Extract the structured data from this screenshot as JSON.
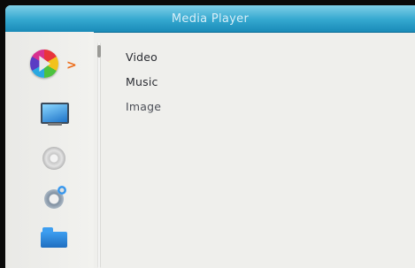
{
  "window": {
    "title": "Media Player"
  },
  "sidebar": {
    "items": [
      {
        "icon": "media-play-icon",
        "selected": true
      },
      {
        "icon": "monitor-icon",
        "selected": false
      },
      {
        "icon": "disc-icon",
        "selected": false
      },
      {
        "icon": "settings-gear-icon",
        "selected": false
      },
      {
        "icon": "folder-icon",
        "selected": false
      }
    ],
    "selection_arrow": ">"
  },
  "menu": {
    "items": [
      {
        "label": "Video"
      },
      {
        "label": "Music"
      },
      {
        "label": "Image"
      }
    ]
  },
  "colors": {
    "titlebar": "#33a7cf",
    "background": "#efefec",
    "arrow": "#ec6d1b",
    "text": "#2b2d33"
  }
}
